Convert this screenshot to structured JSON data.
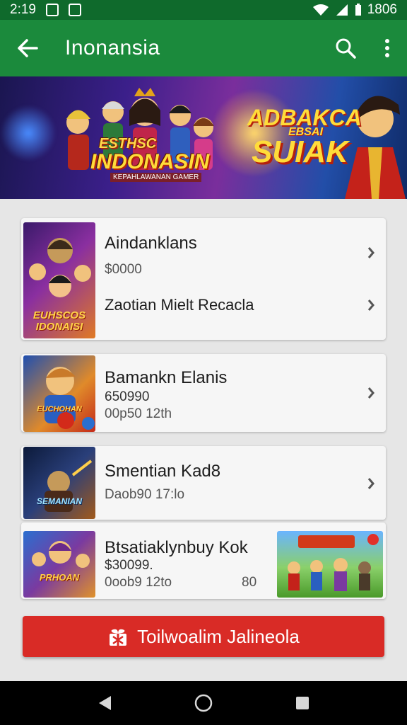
{
  "status_bar": {
    "time": "2:19",
    "battery_text": "1806"
  },
  "app_bar": {
    "title": "Inonansia",
    "back_icon": "arrow-left-icon",
    "search_icon": "search-icon",
    "more_icon": "more-vert-icon"
  },
  "banner": {
    "title_top": "ESTHSC",
    "title_main": "INDONASIN",
    "subtitle": "KEPAHLAWANAN GAMER",
    "right_1": "ADBAKCA",
    "right_2": "EBSAI",
    "right_3": "SUIAK"
  },
  "items": [
    {
      "name": "Aindanklans",
      "price": "$0000",
      "second_line": "Zaotian Mielt Recacla",
      "thumb_caption": "EUHSCOS IDONAISI"
    },
    {
      "name": "Bamankn Elanis",
      "price": "650990",
      "meta": "00p50 12th",
      "thumb_caption": "EUCHOHAN"
    },
    {
      "name": "Smentian Kad8",
      "meta": "Daob90 17:lo",
      "thumb_caption": "SEMANIAN"
    },
    {
      "name": "Btsatiaklynbuy Kok",
      "price": "$30099.",
      "meta": "0oob9 12to",
      "extra": "80",
      "thumb_caption": "PRHOAN"
    }
  ],
  "cta": {
    "label": "Toilwoalim Jalineola",
    "icon": "gift-icon"
  },
  "colors": {
    "primary": "#1b8a3c",
    "status_bar": "#0f6a2c",
    "accent": "#d92b26"
  }
}
